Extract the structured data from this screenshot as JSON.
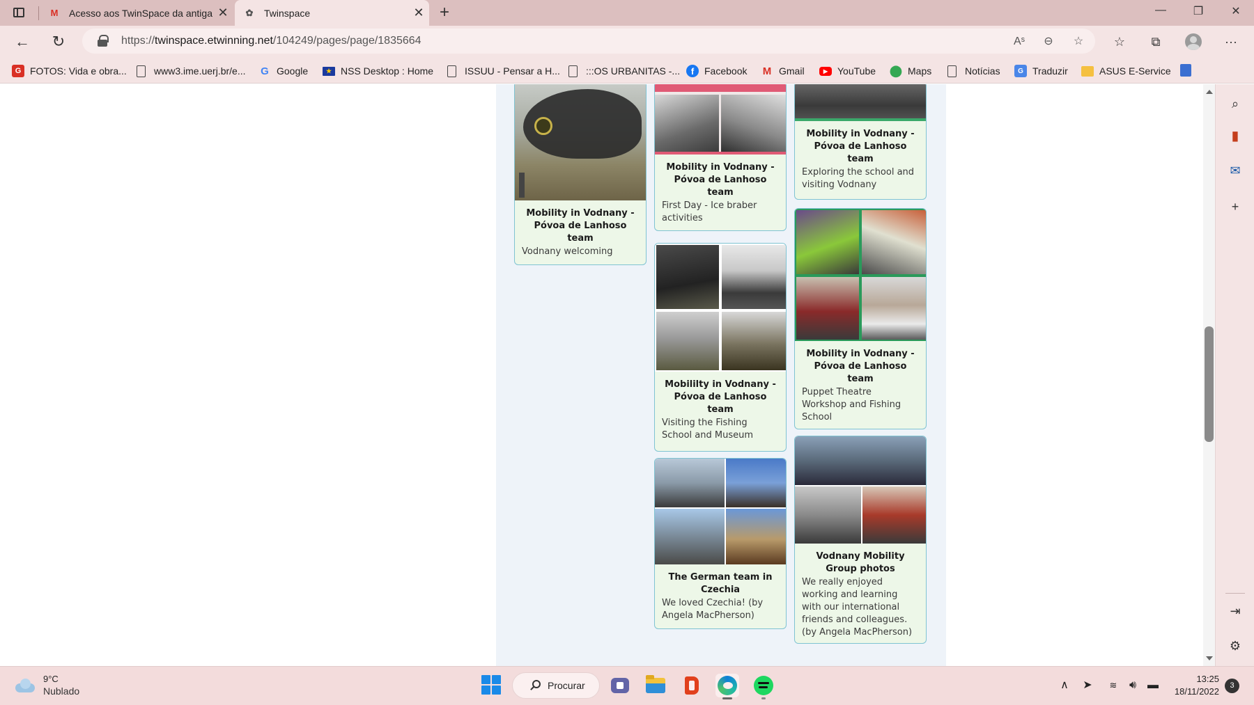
{
  "browser": {
    "tabs": [
      {
        "label": "Acesso aos TwinSpace da antiga",
        "favicon": "gmail-icon"
      },
      {
        "label": "Twinspace",
        "favicon": "twinspace-icon"
      }
    ],
    "url": {
      "prefix": "https://",
      "host": "twinspace.etwinning.net",
      "path": "/104249/pages/page/1835664"
    },
    "favorites": [
      {
        "label": "FOTOS: Vida e obra...",
        "icon": "fotos-icon"
      },
      {
        "label": "www3.ime.uerj.br/e...",
        "icon": "page-icon"
      },
      {
        "label": "Google",
        "icon": "google-icon"
      },
      {
        "label": "NSS Desktop : Home",
        "icon": "eu-flag-icon"
      },
      {
        "label": "ISSUU - Pensar a H...",
        "icon": "page-icon"
      },
      {
        "label": ":::OS URBANITAS -...",
        "icon": "page-icon"
      },
      {
        "label": "Facebook",
        "icon": "facebook-icon"
      },
      {
        "label": "Gmail",
        "icon": "gmail-icon"
      },
      {
        "label": "YouTube",
        "icon": "youtube-icon"
      },
      {
        "label": "Maps",
        "icon": "maps-icon"
      },
      {
        "label": "Notícias",
        "icon": "page-icon"
      },
      {
        "label": "Traduzir",
        "icon": "translate-icon"
      },
      {
        "label": "ASUS E-Service",
        "icon": "folder-icon"
      }
    ]
  },
  "gallery": [
    {
      "title": "Mobility in Vodnany - Póvoa de Lanhoso team",
      "desc": "Vodnany welcoming"
    },
    {
      "title": "Mobility in Vodnany - Póvoa de Lanhoso team",
      "desc": "First Day - Ice braber activities"
    },
    {
      "title": "Mobililty in Vodnany - Póvoa de Lanhoso team",
      "desc": "Visiting the Fishing School and Museum"
    },
    {
      "title": "The German team in Czechia",
      "desc": "We loved Czechia! (by Angela MacPherson)"
    },
    {
      "title": "Mobility in Vodnany - Póvoa de Lanhoso team",
      "desc": "Exploring the school and visiting Vodnany"
    },
    {
      "title": "Mobility in Vodnany - Póvoa de Lanhoso team",
      "desc": "Puppet Theatre Workshop and Fishing School"
    },
    {
      "title": "Vodnany Mobility Group photos",
      "desc": "We really enjoyed working and learning with our international friends and colleagues. (by Angela MacPherson)"
    }
  ],
  "taskbar": {
    "weather": {
      "temp": "9°C",
      "condition": "Nublado"
    },
    "search_label": "Procurar",
    "time": "13:25",
    "date": "18/11/2022",
    "notifications": "3"
  },
  "colors": {
    "card_bg": "#edf7e8",
    "card_border": "#7fc3d2",
    "chrome": "#f4e4e4",
    "tabstrip": "#dcbfbf"
  }
}
